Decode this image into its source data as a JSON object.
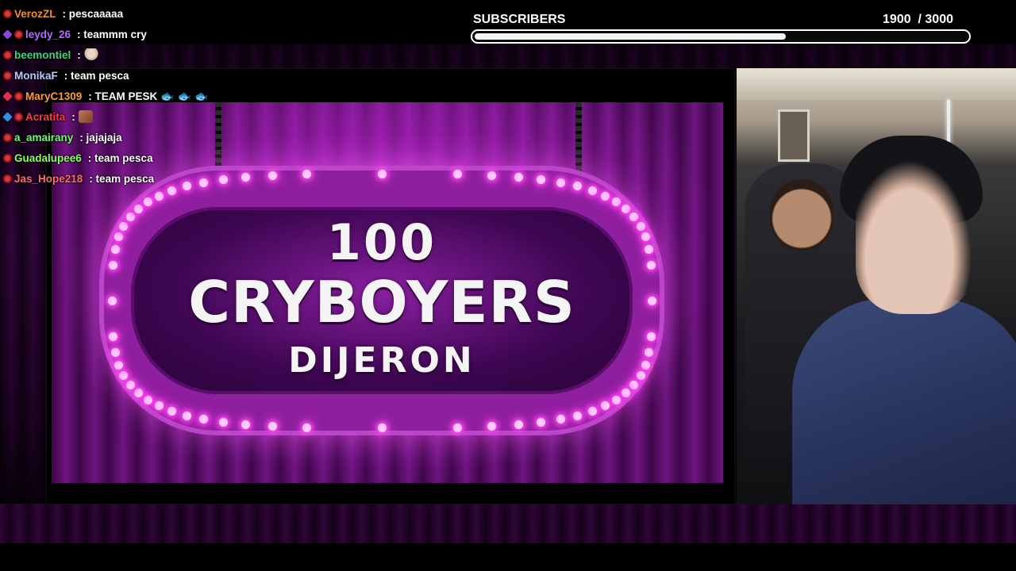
{
  "chat": {
    "messages": [
      {
        "user": "VerozZL",
        "text": ": pescaaaaa",
        "color": "#ff8c1a",
        "badges": [
          "devil"
        ]
      },
      {
        "user": "leydy_26",
        "text": ": teammm cry",
        "color": "#b06bff",
        "badges": [
          "cube-purple",
          "devil"
        ]
      },
      {
        "user": "beemontiel",
        "text": ":",
        "color": "#33d977",
        "badges": [
          "devil"
        ],
        "emote": "person"
      },
      {
        "user": "MonikaF",
        "text": ": team pesca",
        "color": "#b9c8ff",
        "badges": [
          "devil"
        ]
      },
      {
        "user": "MaryC1309",
        "text": ": TEAM PESK",
        "color": "#ff9a2e",
        "badges": [
          "cube-red",
          "devil"
        ],
        "emote": "fish"
      },
      {
        "user": "Acratita",
        "text": ":",
        "color": "#ff3b3b",
        "badges": [
          "cube-blue",
          "devil"
        ],
        "emote": "face"
      },
      {
        "user": "a_amairany",
        "text": ": jajajaja",
        "color": "#6bff6b",
        "badges": [
          "devil"
        ]
      },
      {
        "user": "Guadalupee6",
        "text": ": team pesca",
        "color": "#8aff5a",
        "badges": [
          "devil"
        ]
      },
      {
        "user": "Jas_Hope218",
        "text": ": team pesca",
        "color": "#ff6b6b",
        "badges": [
          "devil"
        ]
      }
    ]
  },
  "subscribers": {
    "label": "SUBSCRIBERS",
    "current": "1900",
    "goal": "/ 3000",
    "progress": 0.633
  },
  "video": {
    "line1": "100",
    "line2": "CRYBOYERS",
    "line3": "DIJERON"
  },
  "colors": {
    "neon": "#ff4df2",
    "sign": "#8e1f9e"
  }
}
